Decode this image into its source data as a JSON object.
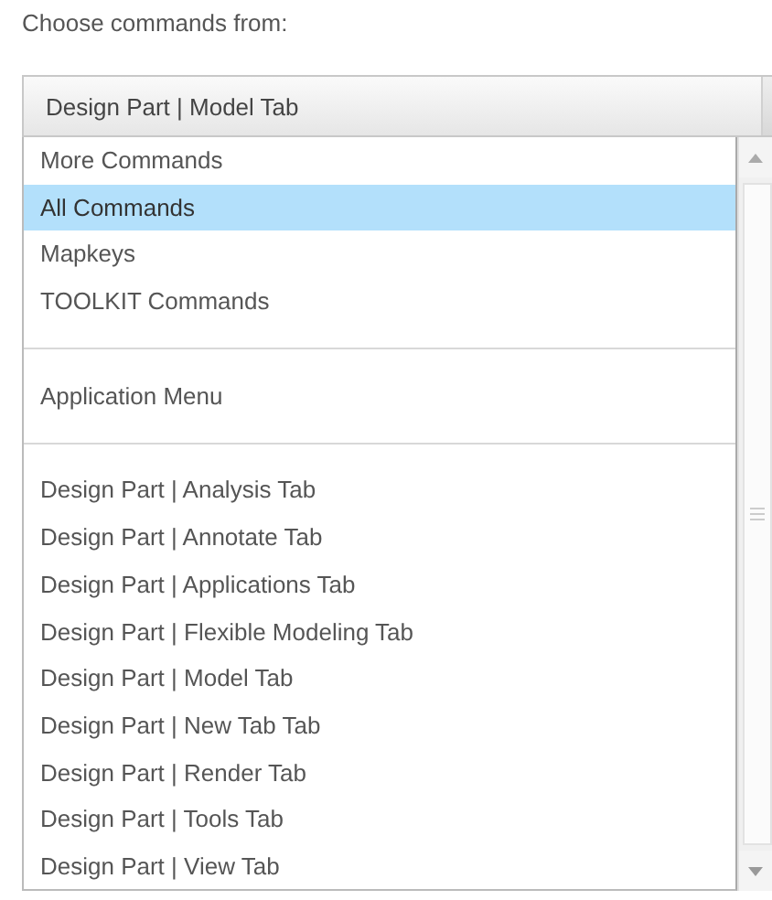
{
  "label": "Choose commands from:",
  "combo": {
    "value": "Design Part | Model Tab"
  },
  "items": [
    {
      "kind": "item",
      "label": "More Commands",
      "selected": false
    },
    {
      "kind": "item",
      "label": "All Commands",
      "selected": true
    },
    {
      "kind": "item",
      "label": "Mapkeys",
      "selected": false
    },
    {
      "kind": "item",
      "label": "TOOLKIT Commands",
      "selected": false
    },
    {
      "kind": "separator"
    },
    {
      "kind": "item",
      "label": "Application Menu",
      "selected": false
    },
    {
      "kind": "separator"
    },
    {
      "kind": "item",
      "label": "Design Part | Analysis Tab",
      "selected": false
    },
    {
      "kind": "item",
      "label": "Design Part | Annotate Tab",
      "selected": false
    },
    {
      "kind": "item",
      "label": "Design Part | Applications Tab",
      "selected": false
    },
    {
      "kind": "item",
      "label": "Design Part | Flexible Modeling Tab",
      "selected": false
    },
    {
      "kind": "item",
      "label": "Design Part | Model Tab",
      "selected": false
    },
    {
      "kind": "item",
      "label": "Design Part | New Tab Tab",
      "selected": false
    },
    {
      "kind": "item",
      "label": "Design Part | Render Tab",
      "selected": false
    },
    {
      "kind": "item",
      "label": "Design Part | Tools Tab",
      "selected": false
    },
    {
      "kind": "item",
      "label": "Design Part | View Tab",
      "selected": false
    }
  ]
}
